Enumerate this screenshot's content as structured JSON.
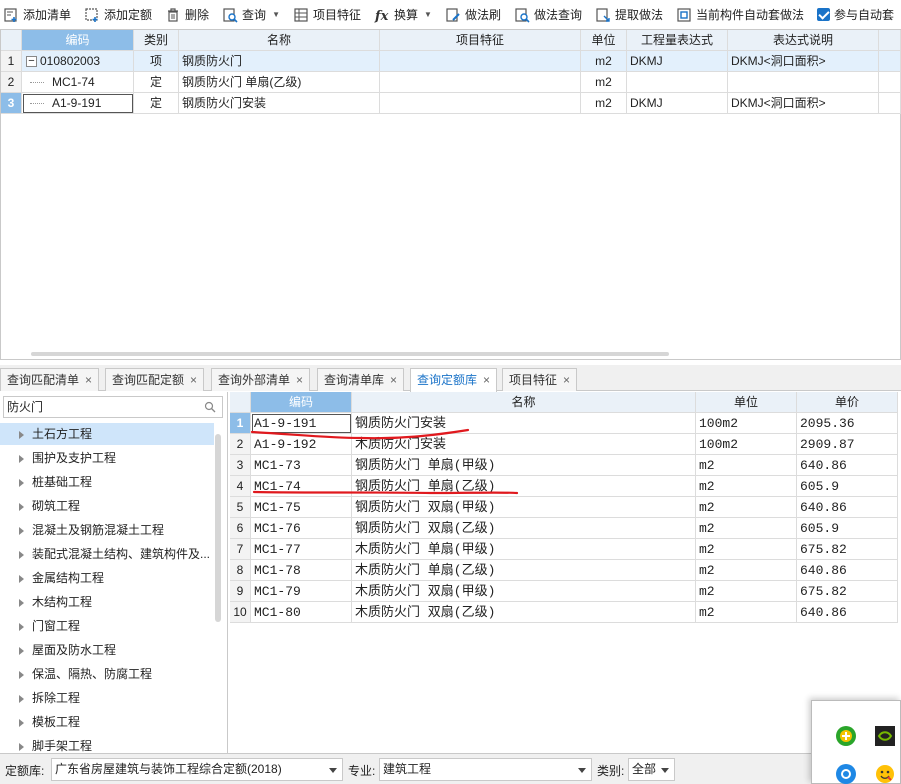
{
  "toolbar": {
    "items": [
      {
        "label": "添加清单",
        "icon": "add-list-icon"
      },
      {
        "label": "添加定额",
        "icon": "add-quota-icon"
      },
      {
        "label": "删除",
        "icon": "trash-icon"
      },
      {
        "label": "查询",
        "icon": "query-icon",
        "dropdown": true
      },
      {
        "label": "项目特征",
        "icon": "feature-icon"
      },
      {
        "label": "换算",
        "icon": "fx-icon",
        "dropdown": true
      },
      {
        "label": "做法刷",
        "icon": "brush-icon"
      },
      {
        "label": "做法查询",
        "icon": "method-query-icon"
      },
      {
        "label": "提取做法",
        "icon": "extract-icon"
      },
      {
        "label": "当前构件自动套做法",
        "icon": "auto-apply-icon"
      }
    ],
    "checkbox_label": "参与自动套",
    "checkbox_checked": true
  },
  "top_grid": {
    "headers": [
      "编码",
      "类别",
      "名称",
      "项目特征",
      "单位",
      "工程量表达式",
      "表达式说明"
    ],
    "rows": [
      {
        "num": "1",
        "code": "010802003",
        "type": "项",
        "name": "钢质防火门",
        "feature": "",
        "unit": "m2",
        "expr": "DKMJ",
        "desc": "DKMJ<洞口面积>"
      },
      {
        "num": "2",
        "code": "MC1-74",
        "type": "定",
        "name": "钢质防火门 单扇(乙级)",
        "feature": "",
        "unit": "m2",
        "expr": "",
        "desc": ""
      },
      {
        "num": "3",
        "code": "A1-9-191",
        "type": "定",
        "name": "钢质防火门安装",
        "feature": "",
        "unit": "m2",
        "expr": "DKMJ",
        "desc": "DKMJ<洞口面积>"
      }
    ],
    "collapse_symbol": "−"
  },
  "tabs": [
    {
      "label": "查询匹配清单"
    },
    {
      "label": "查询匹配定额"
    },
    {
      "label": "查询外部清单"
    },
    {
      "label": "查询清单库"
    },
    {
      "label": "查询定额库",
      "active": true
    },
    {
      "label": "项目特征"
    }
  ],
  "tab_close": "×",
  "search": {
    "value": "防火门"
  },
  "tree": [
    "土石方工程",
    "围护及支护工程",
    "桩基础工程",
    "砌筑工程",
    "混凝土及钢筋混凝土工程",
    "装配式混凝土结构、建筑构件及...",
    "金属结构工程",
    "木结构工程",
    "门窗工程",
    "屋面及防水工程",
    "保温、隔热、防腐工程",
    "拆除工程",
    "模板工程",
    "脚手架工程"
  ],
  "bottom_grid": {
    "headers": [
      "编码",
      "名称",
      "单位",
      "单价"
    ],
    "rows": [
      {
        "num": "1",
        "code": "A1-9-191",
        "name": "钢质防火门安装",
        "unit": "100m2",
        "price": "2095.36"
      },
      {
        "num": "2",
        "code": "A1-9-192",
        "name": "木质防火门安装",
        "unit": "100m2",
        "price": "2909.87"
      },
      {
        "num": "3",
        "code": "MC1-73",
        "name": "钢质防火门 单扇(甲级)",
        "unit": "m2",
        "price": "640.86"
      },
      {
        "num": "4",
        "code": "MC1-74",
        "name": "钢质防火门 单扇(乙级)",
        "unit": "m2",
        "price": "605.9"
      },
      {
        "num": "5",
        "code": "MC1-75",
        "name": "钢质防火门 双扇(甲级)",
        "unit": "m2",
        "price": "640.86"
      },
      {
        "num": "6",
        "code": "MC1-76",
        "name": "钢质防火门 双扇(乙级)",
        "unit": "m2",
        "price": "605.9"
      },
      {
        "num": "7",
        "code": "MC1-77",
        "name": "木质防火门 单扇(甲级)",
        "unit": "m2",
        "price": "675.82"
      },
      {
        "num": "8",
        "code": "MC1-78",
        "name": "木质防火门 单扇(乙级)",
        "unit": "m2",
        "price": "640.86"
      },
      {
        "num": "9",
        "code": "MC1-79",
        "name": "木质防火门 双扇(甲级)",
        "unit": "m2",
        "price": "675.82"
      },
      {
        "num": "10",
        "code": "MC1-80",
        "name": "木质防火门 双扇(乙级)",
        "unit": "m2",
        "price": "640.86"
      }
    ]
  },
  "statusbar": {
    "quota_label": "定额库:",
    "quota_value": "广东省房屋建筑与装饰工程综合定额(2018)",
    "major_label": "专业:",
    "major_value": "建筑工程",
    "category_label": "类别:",
    "category_value": "全部"
  },
  "colors": {
    "accent": "#1a73c8",
    "header_selected": "#8dbde8",
    "annotation": "#e0191e"
  }
}
